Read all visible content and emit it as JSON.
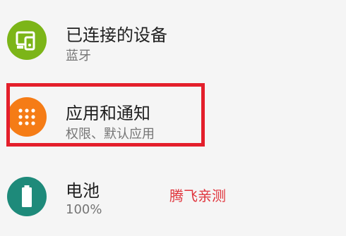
{
  "settings_items": [
    {
      "title": "已连接的设备",
      "subtitle": "蓝牙",
      "icon": "devices-icon",
      "color": "#7cb518"
    },
    {
      "title": "应用和通知",
      "subtitle": "权限、默认应用",
      "icon": "apps-grid-icon",
      "color": "#f57c16"
    },
    {
      "title": "电池",
      "subtitle": "100%",
      "icon": "battery-icon",
      "color": "#1e8a7a"
    }
  ],
  "highlight_color": "#e41f2b",
  "watermark": {
    "text": "腾飞亲测",
    "color": "#e0343c"
  }
}
